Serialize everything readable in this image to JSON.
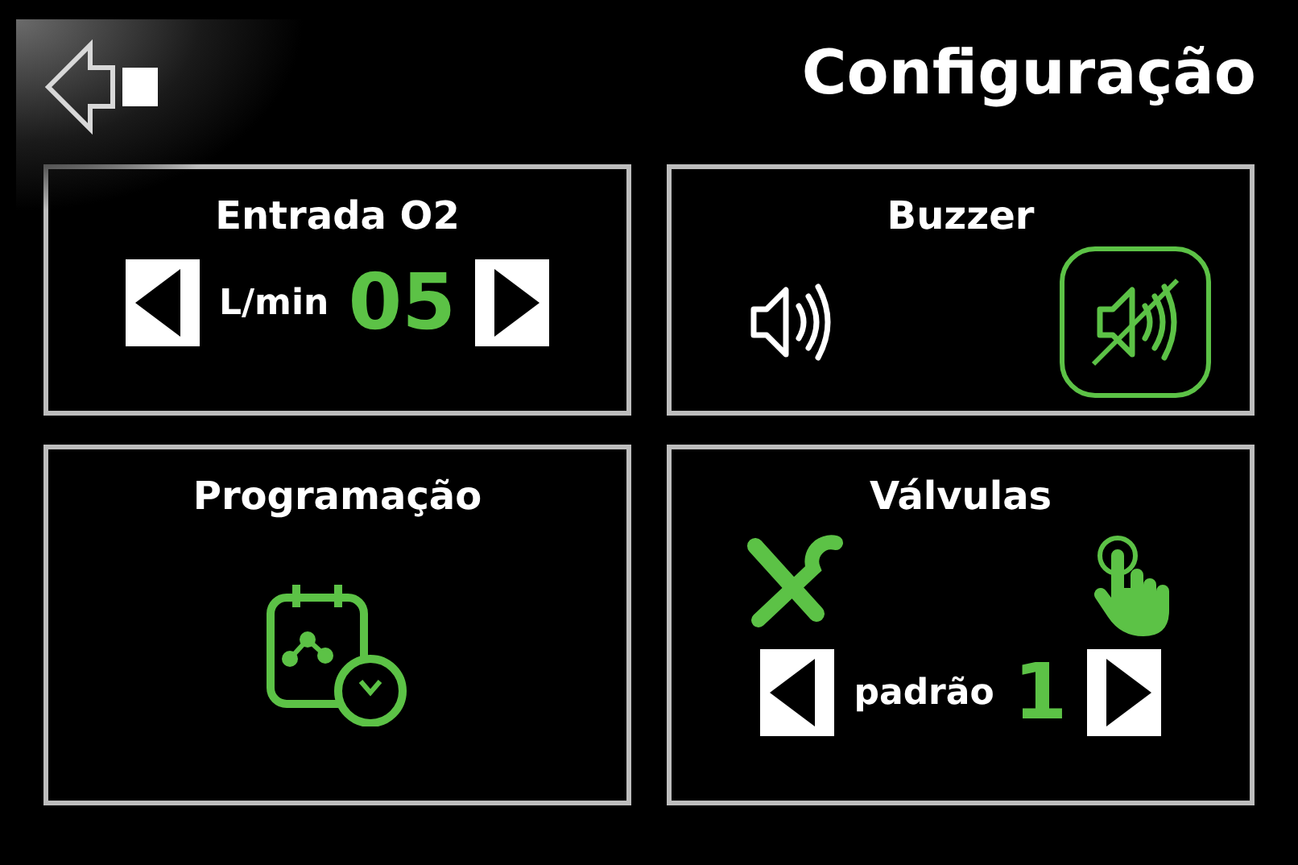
{
  "header": {
    "title": "Configuração"
  },
  "panels": [
    {
      "kind": "stepper",
      "title": "Entrada O2",
      "unit": "L/min",
      "value": "05"
    },
    {
      "kind": "toggle",
      "title": "Buzzer",
      "options": [
        {
          "kind": "sound",
          "selected": false
        },
        {
          "kind": "mute",
          "selected": true
        }
      ]
    },
    {
      "kind": "schedule",
      "title": "Programação"
    },
    {
      "kind": "valves",
      "title": "Válvulas",
      "unit": "padrão",
      "value": "1"
    }
  ]
}
